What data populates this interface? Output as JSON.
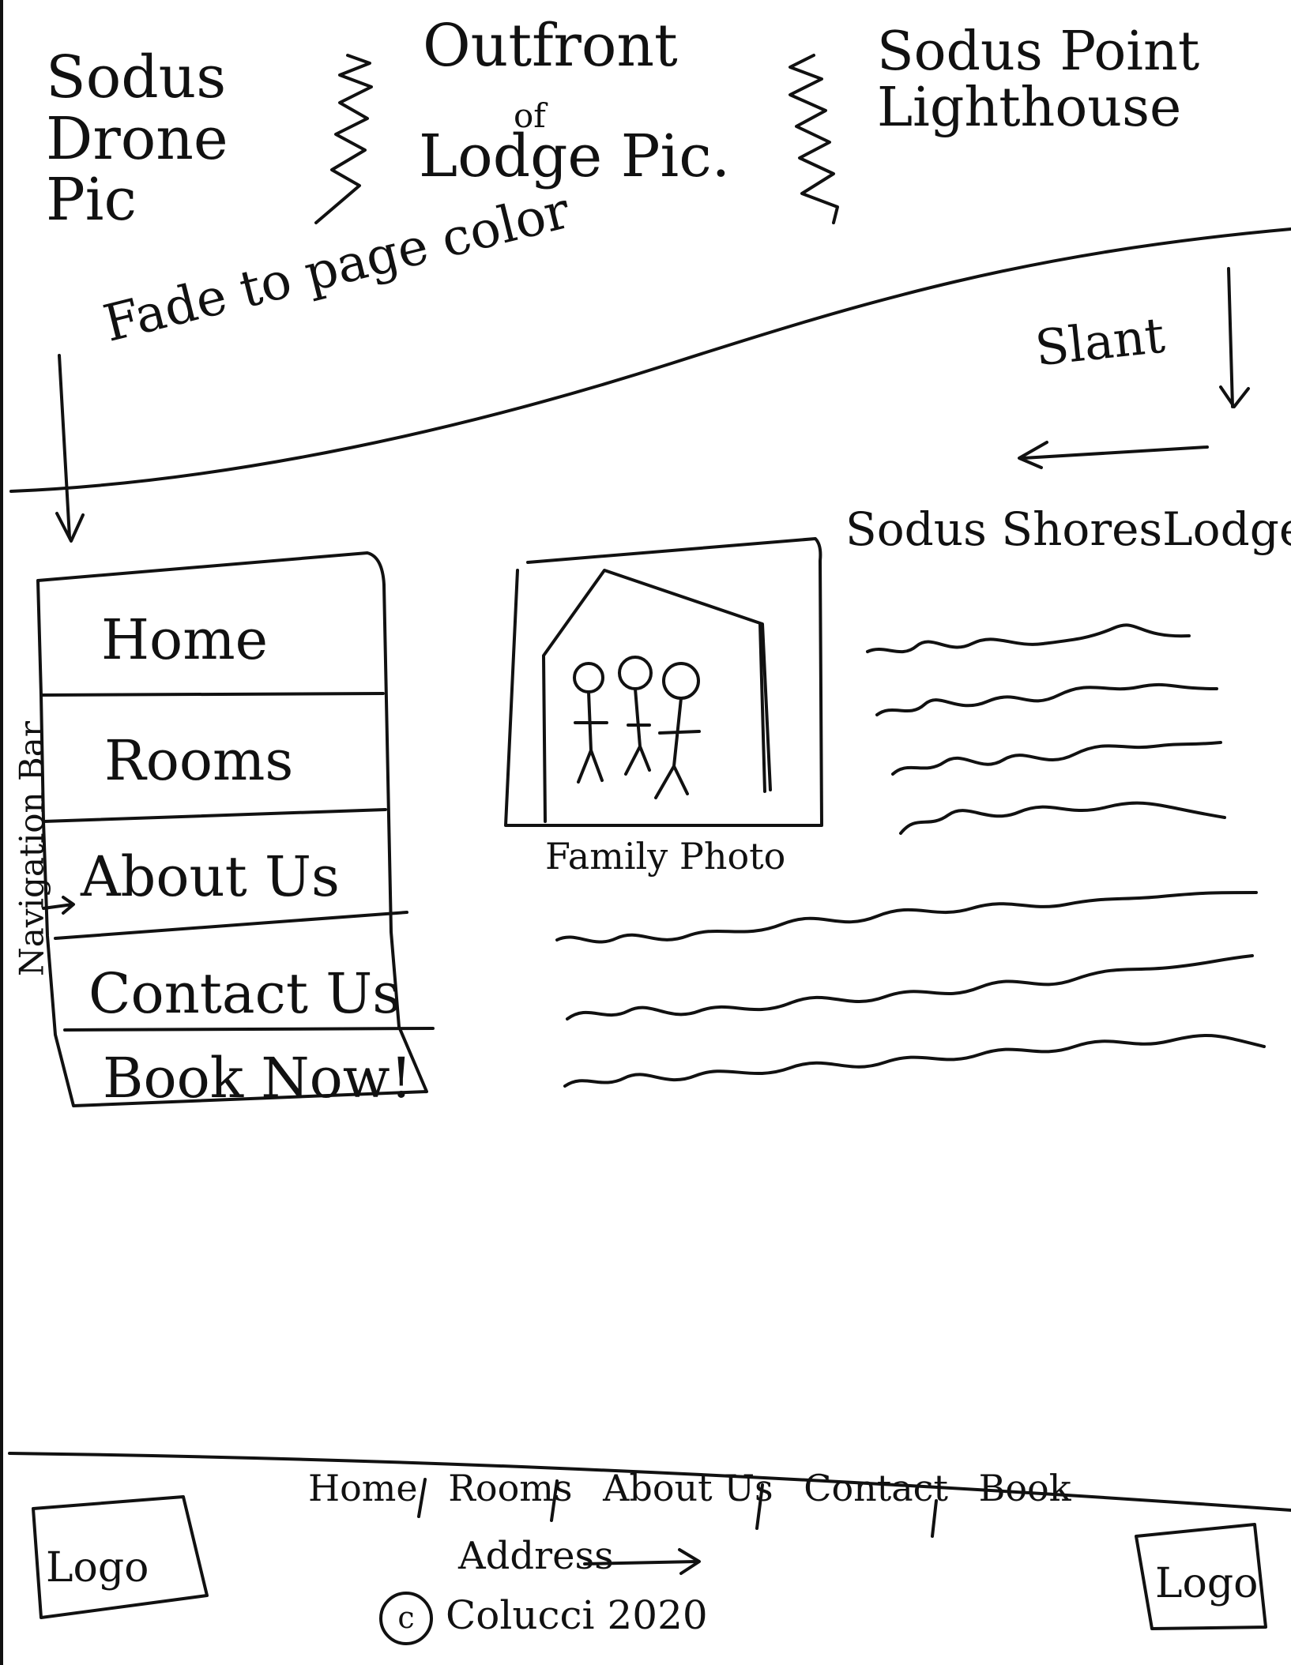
{
  "header": {
    "drone_pic": "Sodus Drone Pic",
    "lodge_pic_line1": "Outfront",
    "lodge_pic_of": "of",
    "lodge_pic_line2": "Lodge Pic.",
    "lighthouse_pic": "Sodus Point Lighthouse"
  },
  "notes": {
    "fade": "Fade to page color",
    "slant": "Slant"
  },
  "nav": {
    "label": "Navigation Bar",
    "items": [
      {
        "label": "Home"
      },
      {
        "label": "Rooms"
      },
      {
        "label": "About Us"
      },
      {
        "label": "Contact Us"
      },
      {
        "label": "Book Now!"
      }
    ]
  },
  "main": {
    "title": "Sodus ShoresLodge",
    "photo_caption": "Family Photo"
  },
  "footer": {
    "links": [
      "Home",
      "Rooms",
      "About Us",
      "Contact",
      "Book"
    ],
    "address": "Address",
    "copyright_symbol": "c",
    "copyright": "Colucci 2020",
    "logo_left": "Logo",
    "logo_right": "Logo"
  }
}
